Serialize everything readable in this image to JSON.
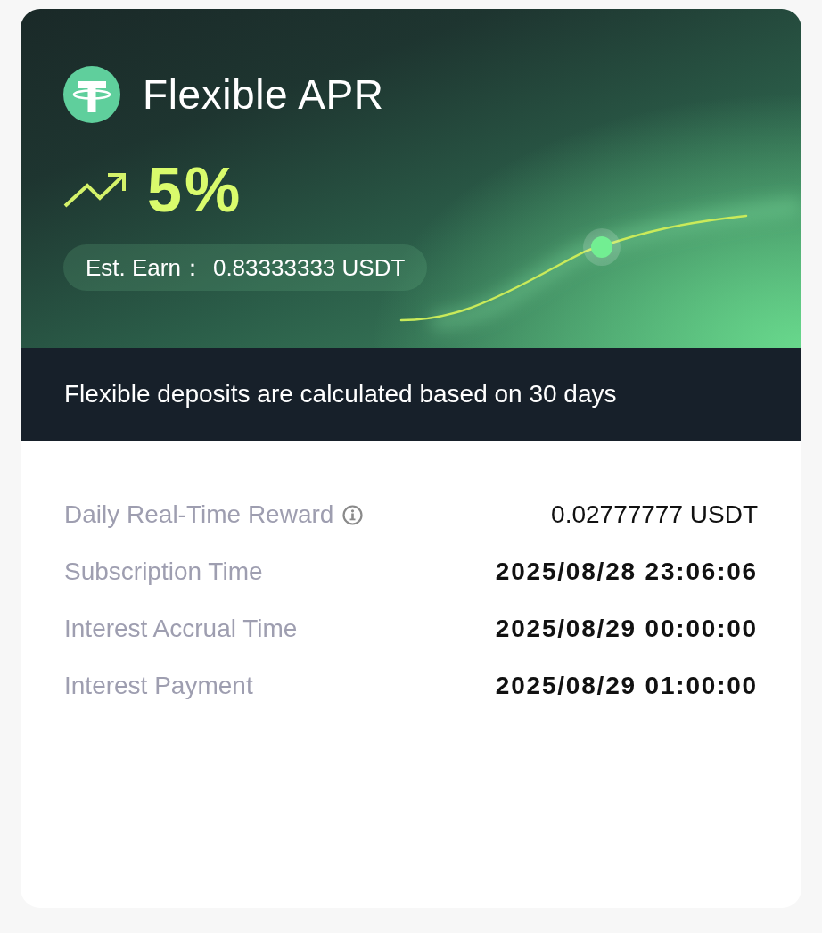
{
  "header": {
    "title": "Flexible APR",
    "rate": "5%",
    "estimate": {
      "label": "Est. Earn：",
      "value": "0.83333333 USDT"
    }
  },
  "notice": "Flexible deposits are calculated based on 30 days",
  "details": [
    {
      "kind": "reward",
      "label": "Daily Real-Time Reward",
      "value": "0.02777777 USDT"
    },
    {
      "kind": "time",
      "label": "Subscription Time",
      "value": "2025/08/28 23:06:06"
    },
    {
      "kind": "time",
      "label": "Interest Accrual Time",
      "value": "2025/08/29 00:00:00"
    },
    {
      "kind": "time",
      "label": "Interest Payment",
      "value": "2025/08/29 01:00:00"
    }
  ]
}
